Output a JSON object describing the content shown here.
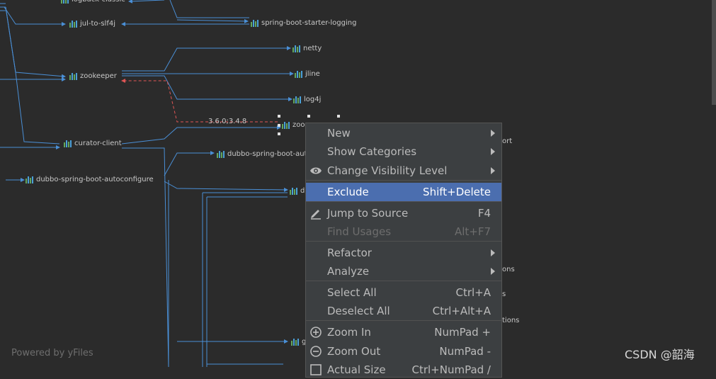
{
  "graph": {
    "nodes": {
      "logback_classic": "logback-classic",
      "jul_to_slf4j": "jul-to-slf4j",
      "spring_boot_starter_logging": "spring-boot-starter-logging",
      "netty": "netty",
      "jline": "jline",
      "zookeeper": "zookeeper",
      "log4j": "log4j",
      "zookeeper_partial": "zoo",
      "curator_client": "curator-client",
      "dubbo_spring_boot_autoconfigure": "dubbo-spring-boot-autoconfigure",
      "dubbo_spring_boot_partial": "dubbo-spring-boot-aut",
      "d_partial": "d",
      "g_partial": "g"
    },
    "edge_label": "3.6.0;3.4.8",
    "partial_texts": [
      "ort",
      "ons",
      "s",
      "tions"
    ],
    "powered_by": "Powered by yFiles"
  },
  "watermark": "CSDN @韶海",
  "context_menu": {
    "items": [
      {
        "label": "New",
        "shortcut": "",
        "submenu": true,
        "icon": ""
      },
      {
        "label": "Show Categories",
        "shortcut": "",
        "submenu": true,
        "icon": ""
      },
      {
        "label": "Change Visibility Level",
        "shortcut": "",
        "submenu": true,
        "icon": "eye-icon"
      },
      {
        "label": "Exclude",
        "shortcut": "Shift+Delete",
        "submenu": false,
        "icon": "",
        "selected": true
      },
      {
        "label": "Jump to Source",
        "shortcut": "F4",
        "submenu": false,
        "icon": "pencil-icon"
      },
      {
        "label": "Find Usages",
        "shortcut": "Alt+F7",
        "submenu": false,
        "icon": "",
        "disabled": true
      },
      {
        "label": "Refactor",
        "shortcut": "",
        "submenu": true,
        "icon": ""
      },
      {
        "label": "Analyze",
        "shortcut": "",
        "submenu": true,
        "icon": ""
      },
      {
        "label": "Select All",
        "shortcut": "Ctrl+A",
        "submenu": false,
        "icon": ""
      },
      {
        "label": "Deselect All",
        "shortcut": "Ctrl+Alt+A",
        "submenu": false,
        "icon": ""
      },
      {
        "label": "Zoom In",
        "shortcut": "NumPad +",
        "submenu": false,
        "icon": "zoom-in-icon"
      },
      {
        "label": "Zoom Out",
        "shortcut": "NumPad -",
        "submenu": false,
        "icon": "zoom-out-icon"
      },
      {
        "label": "Actual Size",
        "shortcut": "Ctrl+NumPad /",
        "submenu": false,
        "icon": "actual-size-icon"
      }
    ]
  },
  "colors": {
    "background": "#2b2b2b",
    "menu_bg": "#3c3f41",
    "selection": "#4b6eaf",
    "edge": "#4a8fd6",
    "conflict_edge": "#e05555"
  }
}
